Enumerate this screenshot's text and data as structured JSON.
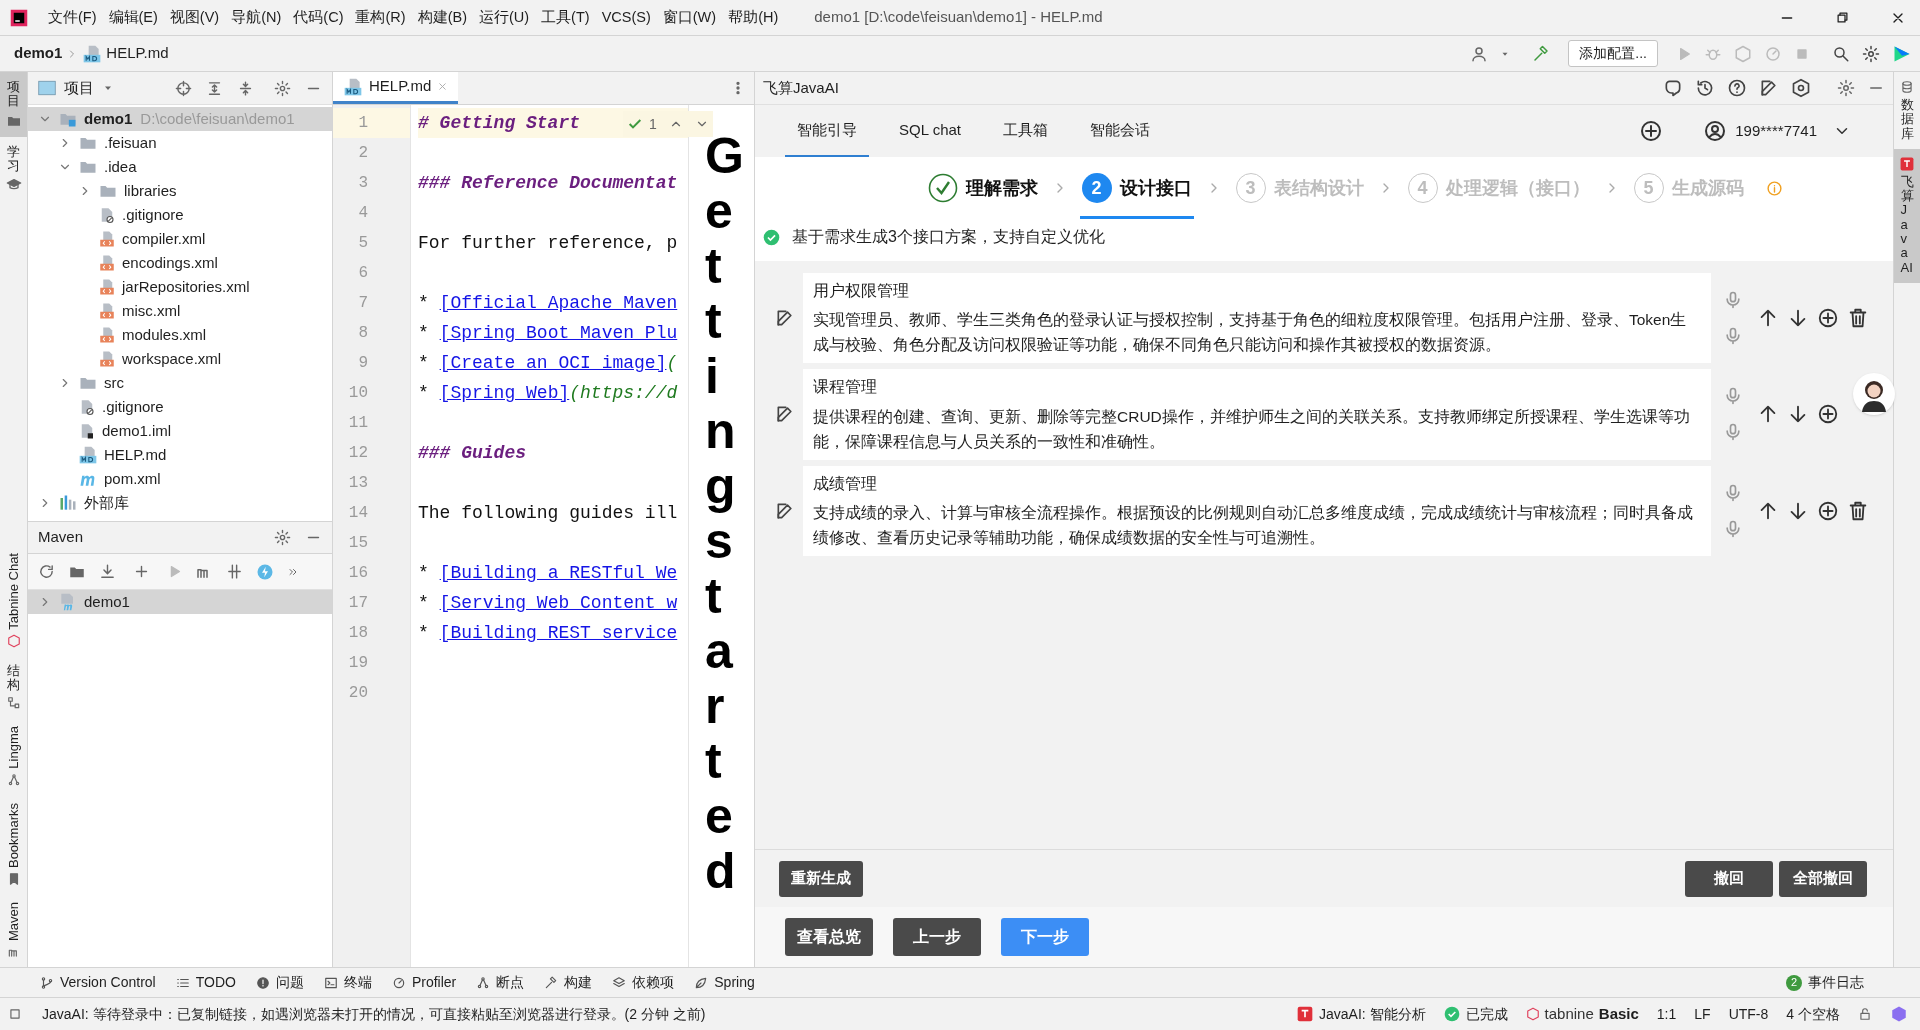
{
  "window": {
    "title": "demo1 [D:\\code\\feisuan\\demo1] - HELP.md",
    "menu": [
      "文件(F)",
      "编辑(E)",
      "视图(V)",
      "导航(N)",
      "代码(C)",
      "重构(R)",
      "构建(B)",
      "运行(U)",
      "工具(T)",
      "VCS(S)",
      "窗口(W)",
      "帮助(H)"
    ]
  },
  "navbar": {
    "breadcrumb": [
      "demo1",
      "HELP.md"
    ],
    "run_config": "添加配置..."
  },
  "left_strip": {
    "top_items": [
      {
        "label": "项目",
        "selected": true
      },
      {
        "label": "学习",
        "selected": false
      }
    ],
    "bottom_items": [
      {
        "label": "Tabnine Chat",
        "selected": false
      },
      {
        "label": "结构",
        "selected": false
      },
      {
        "label": "Lingma",
        "selected": false
      },
      {
        "label": "Bookmarks",
        "selected": false
      },
      {
        "label": "Maven",
        "selected": false
      }
    ]
  },
  "project_panel": {
    "title": "项目",
    "tree": [
      {
        "name": "demo1",
        "path": "D:\\code\\feisuan\\demo1",
        "kind": "module",
        "expanded": true,
        "selected": true,
        "children": [
          {
            "name": ".feisuan",
            "kind": "folder",
            "expanded": false,
            "selected": false
          },
          {
            "name": ".idea",
            "kind": "folder",
            "expanded": true,
            "selected": false,
            "children": [
              {
                "name": "libraries",
                "kind": "folder",
                "expanded": false,
                "selected": false
              },
              {
                "name": ".gitignore",
                "kind": "ignore",
                "selected": false
              },
              {
                "name": "compiler.xml",
                "kind": "xml",
                "selected": false
              },
              {
                "name": "encodings.xml",
                "kind": "xml",
                "selected": false
              },
              {
                "name": "jarRepositories.xml",
                "kind": "xml",
                "selected": false
              },
              {
                "name": "misc.xml",
                "kind": "xml",
                "selected": false
              },
              {
                "name": "modules.xml",
                "kind": "xml",
                "selected": false
              },
              {
                "name": "workspace.xml",
                "kind": "xml",
                "selected": false
              }
            ]
          },
          {
            "name": "src",
            "kind": "folder",
            "expanded": false,
            "selected": false
          },
          {
            "name": ".gitignore",
            "kind": "ignore",
            "selected": false
          },
          {
            "name": "demo1.iml",
            "kind": "iml",
            "selected": false
          },
          {
            "name": "HELP.md",
            "kind": "md",
            "selected": false
          },
          {
            "name": "pom.xml",
            "kind": "maven",
            "selected": false
          }
        ]
      },
      {
        "name": "外部库",
        "kind": "library",
        "expanded": false,
        "selected": false
      }
    ]
  },
  "maven_panel": {
    "title": "Maven",
    "tree": [
      {
        "name": "demo1",
        "kind": "maven-module",
        "expanded": false,
        "selected": true
      }
    ]
  },
  "editor": {
    "tab": {
      "label": "HELP.md",
      "selected": true
    },
    "inspection": {
      "count": "1"
    },
    "lines": [
      {
        "number": "1",
        "segments": [
          {
            "kind": "heading",
            "text": "# Getting Start"
          }
        ]
      },
      {
        "number": "2"
      },
      {
        "number": "3",
        "segments": [
          {
            "kind": "heading",
            "text": "### Reference Documentat"
          }
        ]
      },
      {
        "number": "4"
      },
      {
        "number": "5",
        "segments": [
          {
            "kind": "text",
            "text": "For further reference, p"
          }
        ]
      },
      {
        "number": "6"
      },
      {
        "number": "7",
        "segments": [
          {
            "kind": "text",
            "text": "* "
          },
          {
            "kind": "link",
            "text": "[Official Apache Maven"
          }
        ]
      },
      {
        "number": "8",
        "segments": [
          {
            "kind": "text",
            "text": "* "
          },
          {
            "kind": "link",
            "text": "[Spring Boot Maven Plu"
          }
        ]
      },
      {
        "number": "9",
        "segments": [
          {
            "kind": "text",
            "text": "* "
          },
          {
            "kind": "link",
            "text": "[Create an OCI image]"
          },
          {
            "kind": "url",
            "text": "("
          }
        ]
      },
      {
        "number": "10",
        "segments": [
          {
            "kind": "text",
            "text": "* "
          },
          {
            "kind": "link",
            "text": "[Spring Web]"
          },
          {
            "kind": "url",
            "text": "(https://d"
          }
        ]
      },
      {
        "number": "11"
      },
      {
        "number": "12",
        "segments": [
          {
            "kind": "heading",
            "text": "### Guides"
          }
        ]
      },
      {
        "number": "13"
      },
      {
        "number": "14",
        "segments": [
          {
            "kind": "text",
            "text": "The following guides ill"
          }
        ]
      },
      {
        "number": "15"
      },
      {
        "number": "16",
        "segments": [
          {
            "kind": "text",
            "text": "* "
          },
          {
            "kind": "link",
            "text": "[Building a RESTful We"
          }
        ]
      },
      {
        "number": "17",
        "segments": [
          {
            "kind": "text",
            "text": "* "
          },
          {
            "kind": "link",
            "text": "[Serving Web Content w"
          }
        ]
      },
      {
        "number": "18",
        "segments": [
          {
            "kind": "text",
            "text": "* "
          },
          {
            "kind": "link",
            "text": "[Building REST service"
          }
        ]
      },
      {
        "number": "19"
      },
      {
        "number": "20"
      }
    ],
    "preview": {
      "text": "Getting started"
    }
  },
  "ai_panel": {
    "title": "飞算JavaAI",
    "tabs": [
      {
        "label": "智能引导",
        "selected": true
      },
      {
        "label": "SQL chat",
        "selected": false
      },
      {
        "label": "工具箱",
        "selected": false
      },
      {
        "label": "智能会话",
        "selected": false
      }
    ],
    "account": "199****7741",
    "steps": [
      {
        "label": "理解需求",
        "done": true,
        "selected": false
      },
      {
        "number": "2",
        "label": "设计接口",
        "done": false,
        "selected": true
      },
      {
        "number": "3",
        "label": "表结构设计",
        "done": false,
        "selected": false
      },
      {
        "number": "4",
        "label": "处理逻辑（接口）",
        "done": false,
        "selected": false
      },
      {
        "number": "5",
        "label": "生成源码",
        "done": false,
        "selected": false
      }
    ],
    "notice": "基于需求生成3个接口方案，支持自定义优化",
    "cards": [
      {
        "title": "用户权限管理",
        "description": "实现管理员、教师、学生三类角色的登录认证与授权控制，支持基于角色的细粒度权限管理。包括用户注册、登录、Token生成与校验、角色分配及访问权限验证等功能，确保不同角色只能访问和操作其被授权的数据资源。",
        "deletable": true
      },
      {
        "title": "课程管理",
        "description": "提供课程的创建、查询、更新、删除等完整CRUD操作，并维护师生之间的关联关系。支持教师绑定所授课程、学生选课等功能，保障课程信息与人员关系的一致性和准确性。",
        "deletable": false
      },
      {
        "title": "成绩管理",
        "description": "支持成绩的录入、计算与审核全流程操作。根据预设的比例规则自动汇总多维度成绩，完成成绩统计与审核流程；同时具备成绩修改、查看历史记录等辅助功能，确保成绩数据的安全性与可追溯性。",
        "deletable": true
      }
    ],
    "actions": {
      "left": [
        "重新生成"
      ],
      "right": [
        "撤回",
        "全部撤回"
      ]
    },
    "nav_buttons": [
      {
        "label": "查看总览",
        "primary": false
      },
      {
        "label": "上一步",
        "primary": false
      },
      {
        "label": "下一步",
        "primary": true
      }
    ]
  },
  "right_strip": [
    {
      "label": "数据库",
      "selected": false
    },
    {
      "label": "飞算JavaAI",
      "selected": true
    }
  ],
  "tool_windows": [
    {
      "label": "Version Control",
      "kind": "vcs"
    },
    {
      "label": "TODO",
      "kind": "list"
    },
    {
      "label": "问题",
      "kind": "problems"
    },
    {
      "label": "终端",
      "kind": "terminal"
    },
    {
      "label": "Profiler",
      "kind": "profiler"
    },
    {
      "label": "断点",
      "kind": "breakpoints"
    },
    {
      "label": "构建",
      "kind": "build"
    },
    {
      "label": "依赖项",
      "kind": "deps"
    },
    {
      "label": "Spring",
      "kind": "spring"
    }
  ],
  "event_log": {
    "count": "2",
    "label": "事件日志"
  },
  "status_bar": {
    "message": "JavaAI: 等待登录中：已复制链接，如遇浏览器未打开的情况，可直接粘贴至浏览器进行登录。(2 分钟 之前)",
    "plugin": "JavaAI: 智能分析",
    "plugin_status": "已完成",
    "tabnine": "tabnine",
    "tabnine_plan": "Basic",
    "position": "1:1",
    "line_ending": "LF",
    "encoding": "UTF-8",
    "indent": "4 个空格"
  }
}
